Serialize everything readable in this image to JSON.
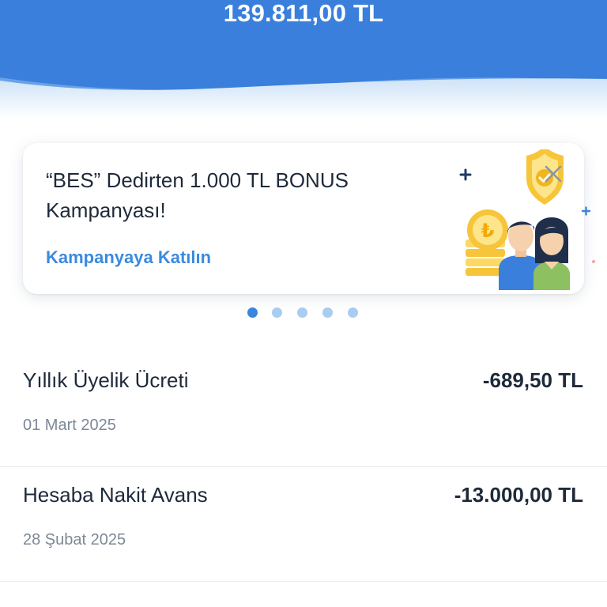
{
  "header": {
    "balance": "139.811,00 TL"
  },
  "campaign": {
    "title": "“BES” Dedirten 1.000 TL BONUS Kampanyası!",
    "link_label": "Kampanyaya Katılın",
    "illustration": "couple-with-coins-and-shield",
    "close_icon": "close-icon"
  },
  "carousel": {
    "total_pages": 5,
    "active_index": 0
  },
  "transactions": [
    {
      "name": "Yıllık Üyelik Ücreti",
      "amount": "-689,50 TL",
      "date": "01 Mart 2025"
    },
    {
      "name": "Hesaba Nakit Avans",
      "amount": "-13.000,00 TL",
      "date": "28 Şubat 2025"
    }
  ],
  "colors": {
    "header_blue": "#3a7fdc",
    "link_blue": "#3a8ae0",
    "dot_active": "#3a85dd",
    "dot_inactive": "#a9cdf0",
    "text_dark": "#1e2a3a",
    "text_muted": "#7d8896"
  }
}
